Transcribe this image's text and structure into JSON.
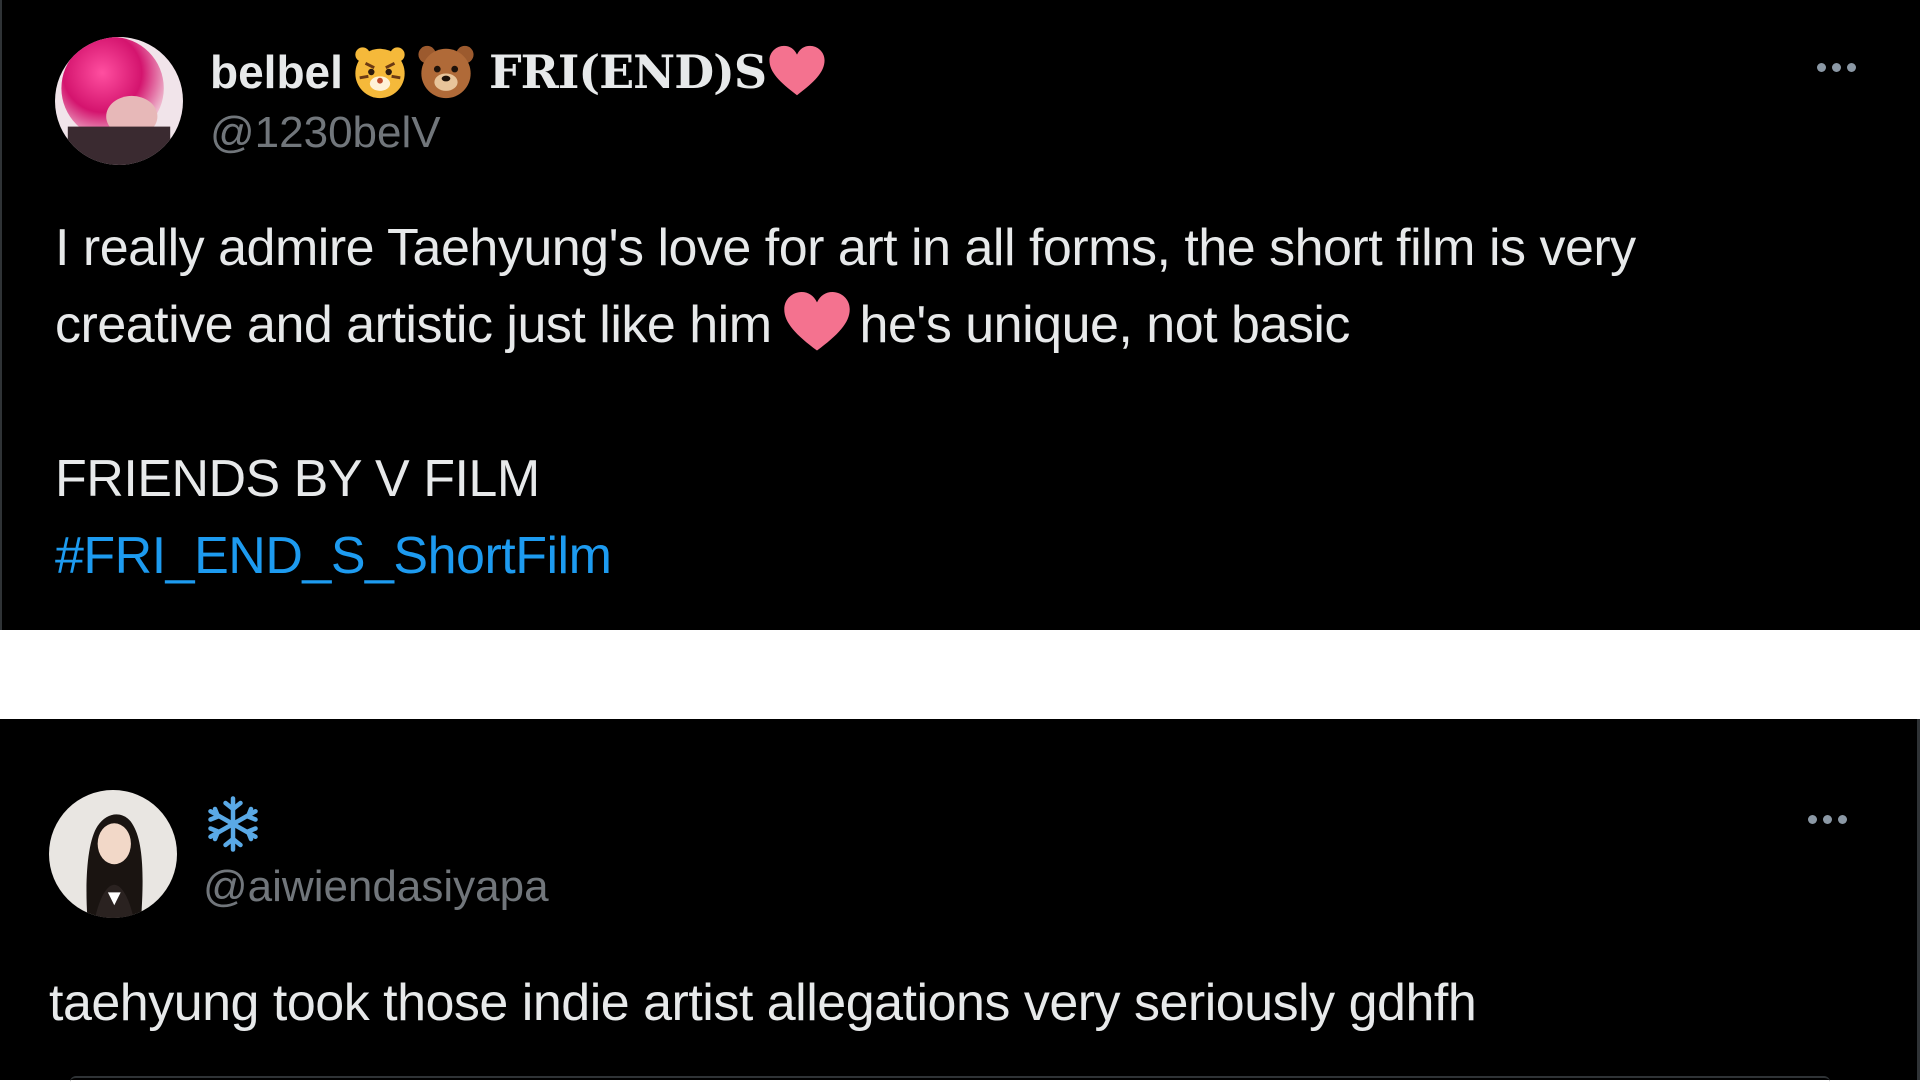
{
  "tweets": [
    {
      "display_name": "belbel",
      "name_emojis": [
        "tiger-face-icon",
        "bear-face-icon"
      ],
      "name_suffix": "FRI(END)S",
      "handle": "@1230belV",
      "text_line1": "I really admire Taehyung's love for art in all forms, the short film is very",
      "text_line2a": "creative and artistic just like him",
      "text_line2b": "he's unique, not basic",
      "text_line3": "FRIENDS BY V FILM",
      "hashtag": "#FRI_END_S_ShortFilm",
      "heart_color": "#f4728f"
    },
    {
      "display_name_icon": "snowflake-icon",
      "handle": "@aiwiendasiyapa",
      "text": "taehyung took those indie artist allegations very seriously gdhfh"
    }
  ],
  "colors": {
    "background": "#000000",
    "text": "#e7e9ea",
    "secondary_text": "#71767b",
    "link": "#1d9bf0",
    "snowflake": "#5aa9e6"
  }
}
